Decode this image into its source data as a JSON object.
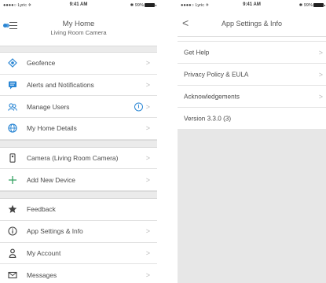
{
  "left_screen": {
    "status": {
      "carrier": "●●●●○ Lyric ✈",
      "time": "9:41 AM",
      "battery": "✱ 99%"
    },
    "header": {
      "title": "My Home",
      "subtitle": "Living Room Camera"
    },
    "groups": [
      [
        {
          "icon": "geofence-icon",
          "label": "Geofence"
        },
        {
          "icon": "alerts-icon",
          "label": "Alerts and Notifications"
        },
        {
          "icon": "users-icon",
          "label": "Manage Users",
          "badge": "i"
        },
        {
          "icon": "globe-icon",
          "label": "My Home Details"
        }
      ],
      [
        {
          "icon": "camera-device-icon",
          "label": "Camera (Living Room Camera)"
        },
        {
          "icon": "plus-icon",
          "label": "Add New Device"
        }
      ],
      [
        {
          "icon": "star-icon",
          "label": "Feedback"
        },
        {
          "icon": "info-icon",
          "label": "App Settings & Info"
        },
        {
          "icon": "account-icon",
          "label": "My Account"
        },
        {
          "icon": "envelope-icon",
          "label": "Messages"
        }
      ]
    ],
    "chevron": ">"
  },
  "right_screen": {
    "status": {
      "carrier": "●●●●○ Lyric ✈",
      "time": "9:41 AM",
      "battery": "✱ 99%"
    },
    "header": {
      "back": "<",
      "title": "App Settings & Info"
    },
    "items": [
      {
        "label": "Get Help",
        "chevron": ">"
      },
      {
        "label": "Privacy Policy & EULA",
        "chevron": ">"
      },
      {
        "label": "Acknowledgements",
        "chevron": ">"
      },
      {
        "label": "Version 3.3.0 (3)",
        "chevron": ""
      }
    ]
  },
  "colors": {
    "accent": "#2a86d4",
    "divider": "#e2e2e2",
    "gap": "#ebebeb"
  }
}
